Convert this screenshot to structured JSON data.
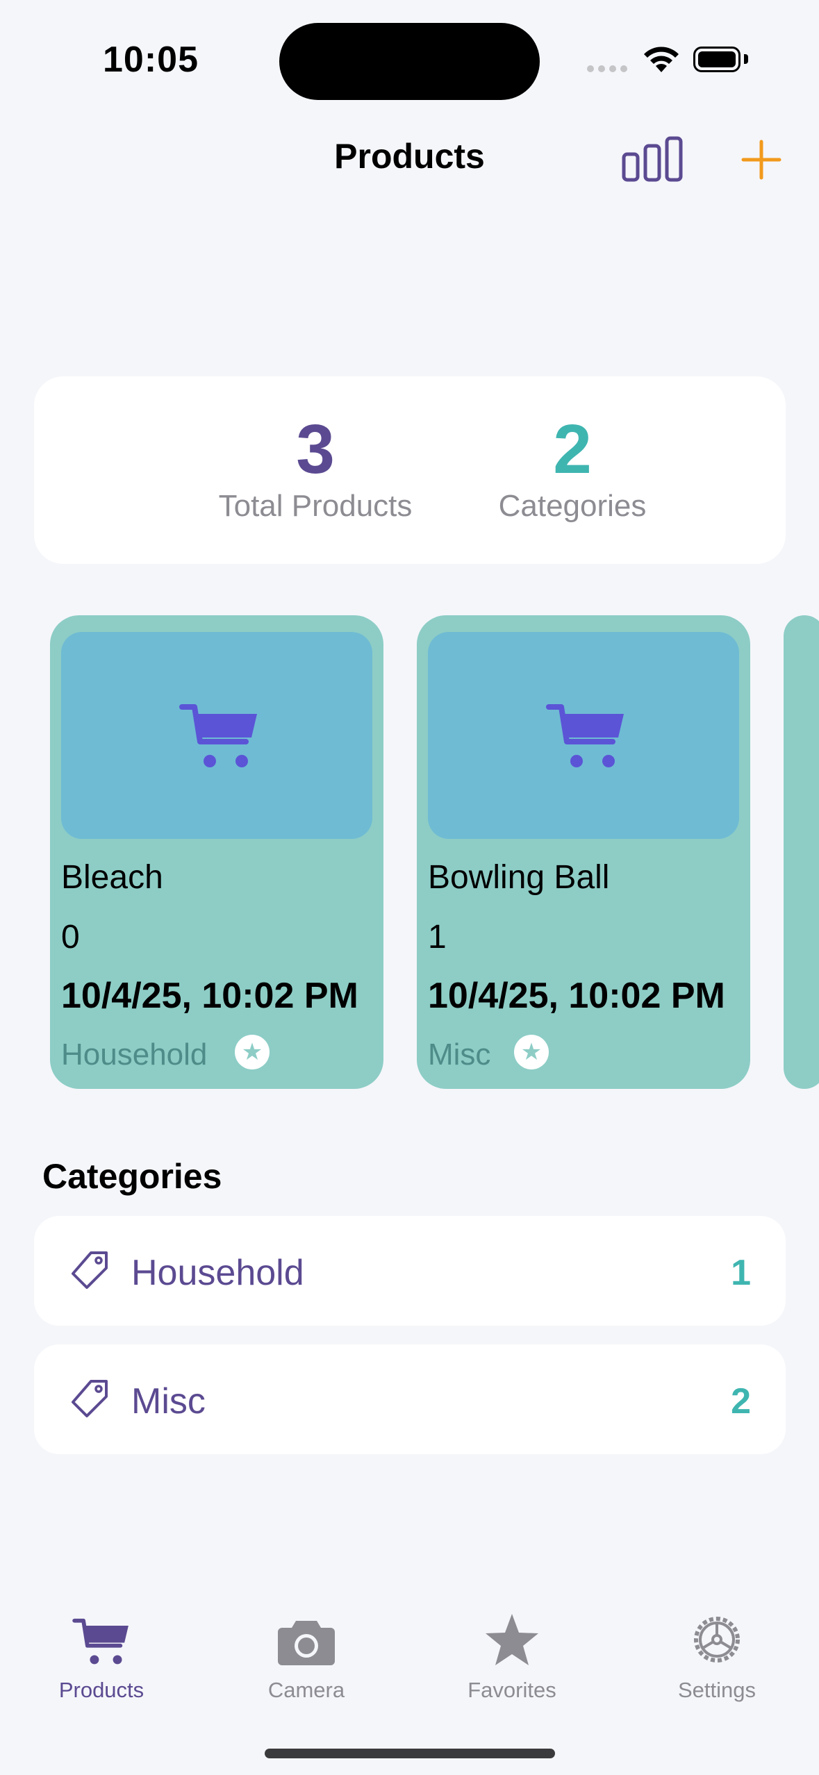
{
  "status_bar": {
    "time": "10:05"
  },
  "nav": {
    "title": "Products",
    "chart_icon": "chart-bars-icon",
    "add_icon": "plus-icon"
  },
  "summary": {
    "total_products": "3",
    "total_products_label": "Total Products",
    "categories": "2",
    "categories_label": "Categories"
  },
  "products": [
    {
      "name": "Bleach",
      "quantity": "0",
      "date": "10/4/25, 10:02 PM",
      "category": "Household",
      "icon": "cart-icon"
    },
    {
      "name": "Bowling Ball",
      "quantity": "1",
      "date": "10/4/25, 10:02 PM",
      "category": "Misc",
      "icon": "cart-icon"
    }
  ],
  "categories_section": {
    "title": "Categories",
    "items": [
      {
        "label": "Household",
        "count": "1",
        "icon": "tag-icon"
      },
      {
        "label": "Misc",
        "count": "2",
        "icon": "tag-icon"
      }
    ]
  },
  "tab_bar": {
    "items": [
      {
        "label": "Products",
        "icon": "cart-icon",
        "active": true
      },
      {
        "label": "Camera",
        "icon": "camera-icon",
        "active": false
      },
      {
        "label": "Favorites",
        "icon": "star-icon",
        "active": false
      },
      {
        "label": "Settings",
        "icon": "gear-icon",
        "active": false
      }
    ]
  },
  "colors": {
    "accent_purple": "#5b4a91",
    "accent_teal": "#3fb5b0",
    "add_orange": "#f29a1c",
    "card_bg": "#8dcdc6",
    "card_image_bg": "#6fbbd4",
    "cart_icon": "#5b54d6"
  }
}
